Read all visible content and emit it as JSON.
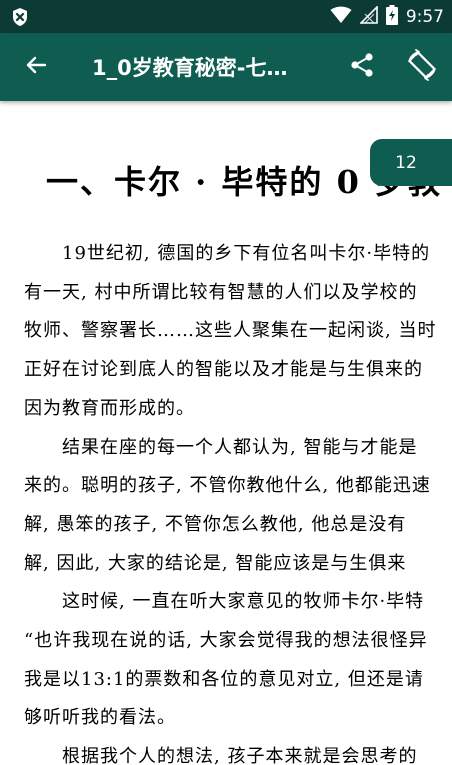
{
  "status_bar": {
    "time": "9:57",
    "icons": [
      "shield-x-icon",
      "wifi-icon",
      "signal-icon",
      "battery-charging-icon"
    ]
  },
  "app_bar": {
    "title": "1_0岁教育秘密-七…",
    "back_icon": "arrow-left-icon",
    "share_icon": "share-icon",
    "rotate_icon": "screen-rotation-icon",
    "color": "#0f5c50"
  },
  "page_badge": "12",
  "document": {
    "heading": "一、卡尔 · 毕特的 0 岁教",
    "lines": [
      {
        "text": "19世纪初, 德国的乡下有位名叫卡尔·毕特的",
        "indent": true
      },
      {
        "text": "有一天, 村中所谓比较有智慧的人们以及学校的",
        "indent": false
      },
      {
        "text": "牧师、警察署长……这些人聚集在一起闲谈, 当时",
        "indent": false
      },
      {
        "text": "正好在讨论到底人的智能以及才能是与生俱来的",
        "indent": false
      },
      {
        "text": "因为教育而形成的。",
        "indent": false
      },
      {
        "text": "结果在座的每一个人都认为, 智能与才能是",
        "indent": true
      },
      {
        "text": "来的。聪明的孩子, 不管你教他什么, 他都能迅速",
        "indent": false
      },
      {
        "text": "解, 愚笨的孩子, 不管你怎么教他, 他总是没有",
        "indent": false
      },
      {
        "text": "解, 因此, 大家的结论是, 智能应该是与生俱来",
        "indent": false
      },
      {
        "text": "这时候, 一直在听大家意见的牧师卡尔·毕特",
        "indent": true
      },
      {
        "text": "“也许我现在说的话, 大家会觉得我的想法很怪异",
        "indent": false
      },
      {
        "text": "我是以13:1的票数和各位的意见对立, 但还是请",
        "indent": false
      },
      {
        "text": "够听听我的看法。",
        "indent": false
      },
      {
        "text": "根据我个人的想法, 孩子本来就是会思考的",
        "indent": true
      }
    ]
  }
}
